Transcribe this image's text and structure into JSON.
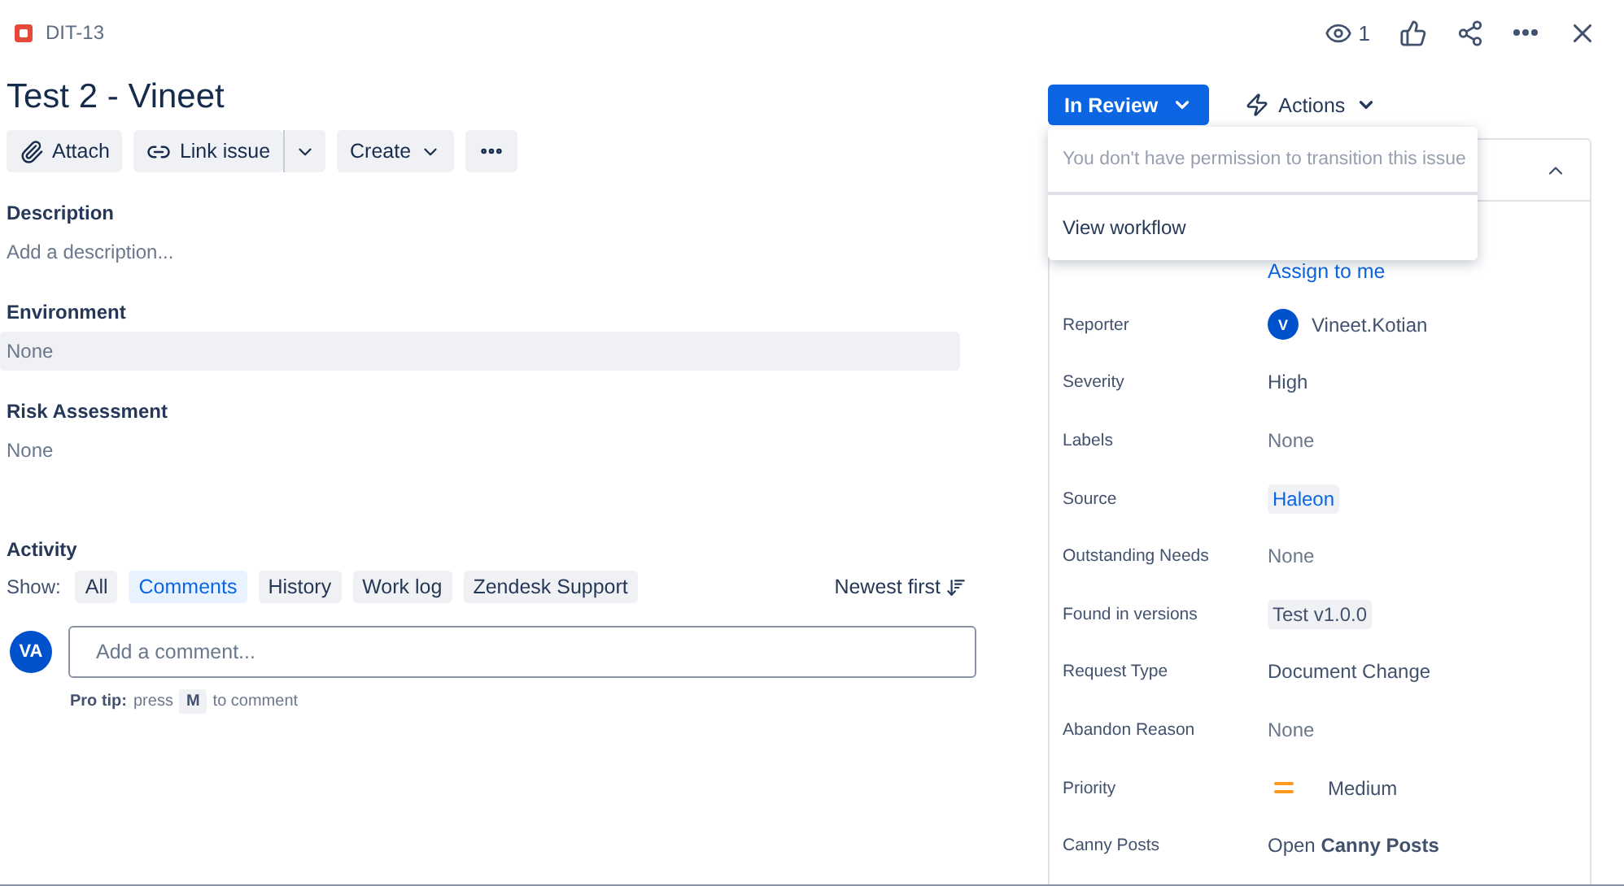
{
  "issue_key": "DIT-13",
  "header_actions": {
    "watchers": "1"
  },
  "title": "Test 2 - Vineet",
  "toolbar": [
    {
      "label": "Attach",
      "kind": "attach"
    },
    {
      "label": "Link issue",
      "kind": "link"
    },
    {
      "label": "Create",
      "kind": "create"
    },
    {
      "kind": "more"
    }
  ],
  "sections": [
    {
      "heading": "Description",
      "value": "Add a description...",
      "shaded": false
    },
    {
      "heading": "Environment",
      "value": "None",
      "shaded": true
    },
    {
      "heading": "Risk Assessment",
      "value": "None",
      "shaded": false
    }
  ],
  "activity": {
    "heading": "Activity",
    "show_label": "Show:",
    "filters": [
      {
        "label": "All",
        "selected": false
      },
      {
        "label": "Comments",
        "selected": true
      },
      {
        "label": "History",
        "selected": false
      },
      {
        "label": "Work log",
        "selected": false
      },
      {
        "label": "Zendesk Support",
        "selected": false
      }
    ],
    "sort": "Newest first",
    "avatar": "VA",
    "comment_placeholder": "Add a comment...",
    "tip_label": "Pro tip:",
    "tip_before": "press",
    "tip_key": "M",
    "tip_after": "to comment"
  },
  "status_button": "In Review",
  "actions_button": "Actions",
  "status_menu": {
    "message": "You don't have permission to transition this issue",
    "items": [
      "View workflow"
    ]
  },
  "assign_link": "Assign to me",
  "fields": [
    {
      "label": "Reporter",
      "value": "Vineet.Kotian",
      "kind": "user",
      "avatar": "V"
    },
    {
      "label": "Severity",
      "value": "High",
      "kind": "text"
    },
    {
      "label": "Labels",
      "value": "None",
      "kind": "empty"
    },
    {
      "label": "Source",
      "value": "Haleon",
      "kind": "link-tag"
    },
    {
      "label": "Outstanding Needs",
      "value": "None",
      "kind": "empty"
    },
    {
      "label": "Found in versions",
      "value": "Test v1.0.0",
      "kind": "tag"
    },
    {
      "label": "Request Type",
      "value": "Document Change",
      "kind": "text"
    },
    {
      "label": "Abandon Reason",
      "value": "None",
      "kind": "empty"
    },
    {
      "label": "Priority",
      "value": "Medium",
      "kind": "priority"
    },
    {
      "label": "Canny Posts",
      "value": "Open **Canny Posts**",
      "kind": "rich"
    }
  ]
}
